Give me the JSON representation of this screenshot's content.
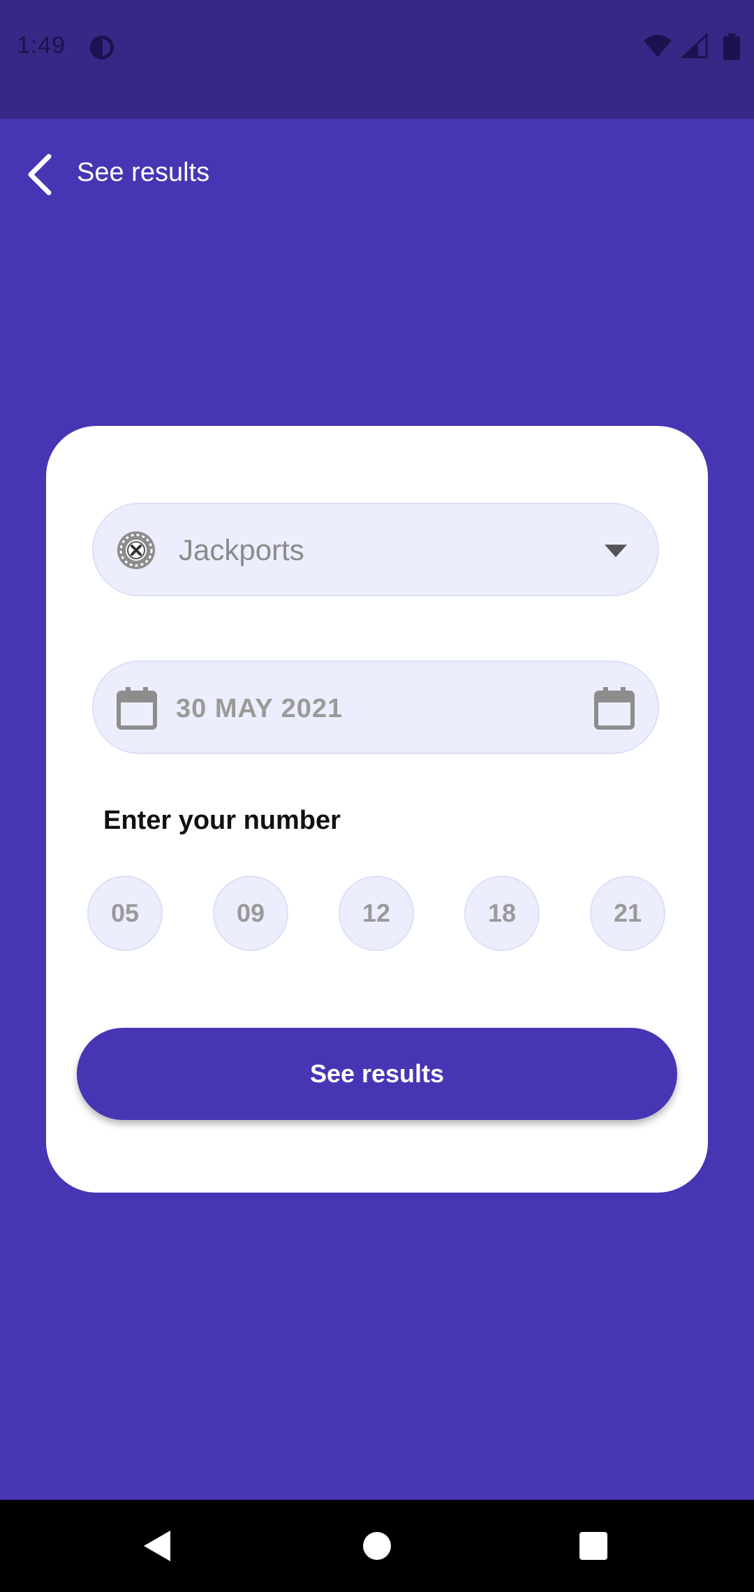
{
  "status_bar": {
    "time": "1:49",
    "icons": [
      "app-notification-icon",
      "wifi-icon",
      "cell-signal-icon",
      "battery-icon"
    ]
  },
  "app_bar": {
    "title": "See results",
    "back_icon": "chevron-left-icon"
  },
  "form": {
    "lottery": {
      "value": "Jackports",
      "icon": "lottery-ball-icon",
      "dropdown_icon": "caret-down-icon"
    },
    "date": {
      "value": "30 MAY 2021",
      "icon": "calendar-icon"
    },
    "numbers_label": "Enter your number",
    "numbers": [
      "05",
      "09",
      "12",
      "18",
      "21"
    ],
    "submit_label": "See results"
  },
  "colors": {
    "primary": "#4636b4",
    "status_bar": "#362985",
    "field_background": "#eceefd",
    "card": "#ffffff"
  },
  "nav_bar": {
    "icons": [
      "nav-back-icon",
      "nav-home-icon",
      "nav-recents-icon"
    ]
  }
}
